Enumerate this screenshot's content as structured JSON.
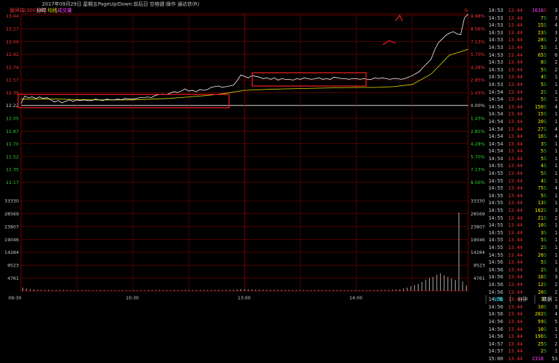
{
  "header": {
    "stock": "銀貝端(300322)",
    "date": "2017年09月29日 星期五",
    "hint": "PageUp/Down:前后日 空格键:操作 通达信(R)",
    "label_minute": "分时",
    "label_avg": "均线",
    "label_vol": "成交量",
    "right_flag": "①"
  },
  "colors": {
    "bg": "#000000",
    "grid": "#800000",
    "price": "#ffffff",
    "avg": "#e8e800",
    "up": "#ff3030",
    "down": "#30d030",
    "flat": "#d0d0d0",
    "volume": "#b0b0b0",
    "box": "#ff2020",
    "text": "#c8c8c8"
  },
  "price_axis": {
    "base": 12.22,
    "left_labels": [
      "13.44",
      "13.27",
      "13.09",
      "12.92",
      "12.74",
      "12.57",
      "12.39",
      "12.22",
      "12.05",
      "11.87",
      "11.70",
      "11.52",
      "11.35",
      "11.17"
    ],
    "right_labels": [
      "9.98%",
      "8.56%",
      "7.13%",
      "5.70%",
      "4.28%",
      "2.85%",
      "1.43%",
      "0.00%",
      "1.43%",
      "2.85%",
      "4.28%",
      "5.70%",
      "7.13%",
      "8.56%"
    ]
  },
  "volume_axis": {
    "labels": [
      "33330",
      "28569",
      "23807",
      "19046",
      "14284",
      "9523",
      "4761"
    ],
    "max": 33330
  },
  "time_axis": [
    "09:30",
    "10:30",
    "13:00",
    "14:00"
  ],
  "chart_data": {
    "type": "line",
    "x_range": [
      0,
      240
    ],
    "y_range": [
      10.998,
      13.442
    ],
    "series": [
      {
        "x": [
          0,
          2,
          4,
          6,
          8,
          10,
          12,
          14,
          16,
          18,
          20,
          22,
          24,
          26,
          28,
          30,
          32,
          34,
          36,
          38,
          40,
          42,
          44,
          46,
          48,
          50,
          52,
          54,
          56,
          58,
          60,
          62,
          64,
          66,
          68,
          70,
          72,
          74,
          76,
          78,
          80,
          82,
          84,
          86,
          88,
          90,
          92,
          94,
          96,
          98,
          100,
          102,
          104,
          106,
          108,
          110,
          112,
          114,
          116,
          118,
          120,
          122,
          124,
          126,
          128,
          130,
          132,
          134,
          136,
          138,
          140,
          142,
          144,
          146,
          148,
          150,
          152,
          154,
          156,
          158,
          160,
          162,
          164,
          166,
          168,
          170,
          172,
          174,
          176,
          178,
          180,
          182,
          184,
          186,
          188,
          190,
          192,
          194,
          196,
          198,
          200,
          202,
          204,
          206,
          208,
          210,
          212,
          214,
          216,
          218,
          220,
          222,
          224,
          226,
          228,
          230,
          232,
          234,
          236,
          238,
          240
        ],
        "values": [
          12.22,
          12.32,
          12.3,
          12.31,
          12.29,
          12.31,
          12.29,
          12.3,
          12.27,
          12.24,
          12.26,
          12.23,
          12.25,
          12.27,
          12.25,
          12.27,
          12.26,
          12.27,
          12.26,
          12.26,
          12.28,
          12.27,
          12.26,
          12.28,
          12.27,
          12.27,
          12.28,
          12.27,
          12.29,
          12.28,
          12.28,
          12.29,
          12.3,
          12.3,
          12.31,
          12.3,
          12.33,
          12.34,
          12.35,
          12.34,
          12.36,
          12.38,
          12.37,
          12.39,
          12.42,
          12.39,
          12.4,
          12.38,
          12.41,
          12.4,
          12.41,
          12.44,
          12.45,
          12.46,
          12.44,
          12.45,
          12.46,
          12.47,
          12.53,
          12.61,
          12.59,
          12.57,
          12.6,
          12.59,
          12.58,
          12.56,
          12.57,
          12.55,
          12.57,
          12.54,
          12.56,
          12.55,
          12.55,
          12.54,
          12.56,
          12.55,
          12.57,
          12.56,
          12.55,
          12.56,
          12.57,
          12.55,
          12.56,
          12.55,
          12.58,
          12.57,
          12.56,
          12.56,
          12.55,
          12.56,
          12.56,
          12.55,
          12.56,
          12.55,
          12.55,
          12.57,
          12.56,
          12.57,
          12.56,
          12.55,
          12.56,
          12.56,
          12.55,
          12.56,
          12.58,
          12.6,
          12.63,
          12.66,
          12.72,
          12.77,
          12.82,
          12.95,
          13.05,
          13.1,
          13.15,
          13.18,
          13.2,
          13.17,
          13.16,
          13.39,
          13.44
        ]
      },
      {
        "x": [
          0,
          20,
          40,
          60,
          80,
          100,
          110,
          120,
          140,
          160,
          180,
          190,
          200,
          210,
          220,
          230,
          240
        ],
        "values": [
          12.28,
          12.28,
          12.27,
          12.27,
          12.29,
          12.33,
          12.36,
          12.4,
          12.42,
          12.43,
          12.44,
          12.44,
          12.45,
          12.48,
          12.62,
          12.88,
          12.96
        ]
      }
    ],
    "volume": [
      1200,
      900,
      600,
      500,
      450,
      400,
      380,
      420,
      350,
      300,
      320,
      360,
      300,
      280,
      260,
      250,
      280,
      300,
      260,
      240,
      230,
      260,
      240,
      220,
      250,
      230,
      210,
      240,
      220,
      200,
      260,
      240,
      230,
      250,
      300,
      280,
      320,
      340,
      300,
      280,
      260,
      300,
      280,
      340,
      380,
      320,
      300,
      280,
      300,
      320,
      400,
      360,
      380,
      420,
      360,
      400,
      380,
      420,
      500,
      700,
      650,
      600,
      560,
      520,
      480,
      450,
      430,
      420,
      400,
      380,
      360,
      380,
      360,
      340,
      320,
      300,
      320,
      300,
      280,
      300,
      320,
      300,
      280,
      300,
      330,
      310,
      300,
      280,
      270,
      290,
      300,
      280,
      260,
      280,
      300,
      320,
      340,
      360,
      380,
      420,
      460,
      520,
      620,
      900,
      1200,
      1800,
      2200,
      2600,
      3400,
      4200,
      4800,
      5200,
      6000,
      6500,
      5800,
      5200,
      4600,
      4000,
      29000,
      3500,
      2000
    ]
  },
  "trades": [
    {
      "t": "14:53",
      "p": "13.44",
      "v": "1616",
      "d": "S",
      "n": "3",
      "dc": "#ff3030",
      "vc": "#ff40ff"
    },
    {
      "t": "14:53",
      "p": "13.44",
      "v": "7",
      "d": "S",
      "n": "3",
      "dc": "#30d030",
      "vc": "#e8e800"
    },
    {
      "t": "14:53",
      "p": "13.44",
      "v": "15",
      "d": "S",
      "n": "4",
      "dc": "#30d030",
      "vc": "#e8e800"
    },
    {
      "t": "14:53",
      "p": "13.44",
      "v": "23",
      "d": "S",
      "n": "3",
      "dc": "#30d030",
      "vc": "#e8e800"
    },
    {
      "t": "14:53",
      "p": "13.44",
      "v": "28",
      "d": "S",
      "n": "2",
      "dc": "#30d030",
      "vc": "#e8e800"
    },
    {
      "t": "14:53",
      "p": "13.44",
      "v": "5",
      "d": "S",
      "n": "1",
      "dc": "#30d030",
      "vc": "#e8e800"
    },
    {
      "t": "14:53",
      "p": "13.44",
      "v": "65",
      "d": "S",
      "n": "6",
      "dc": "#30d030",
      "vc": "#e8e800"
    },
    {
      "t": "14:53",
      "p": "13.44",
      "v": "8",
      "d": "S",
      "n": "2",
      "dc": "#30d030",
      "vc": "#e8e800"
    },
    {
      "t": "14:53",
      "p": "13.44",
      "v": "5",
      "d": "S",
      "n": "2",
      "dc": "#30d030",
      "vc": "#e8e800"
    },
    {
      "t": "14:53",
      "p": "13.44",
      "v": "4",
      "d": "S",
      "n": "1",
      "dc": "#30d030",
      "vc": "#e8e800"
    },
    {
      "t": "14:53",
      "p": "13.44",
      "v": "5",
      "d": "S",
      "n": "1",
      "dc": "#30d030",
      "vc": "#e8e800"
    },
    {
      "t": "14:54",
      "p": "13.44",
      "v": "2",
      "d": "S",
      "n": "1",
      "dc": "#30d030",
      "vc": "#e8e800"
    },
    {
      "t": "14:54",
      "p": "13.44",
      "v": "5",
      "d": "S",
      "n": "1",
      "dc": "#30d030",
      "vc": "#e8e800"
    },
    {
      "t": "14:54",
      "p": "13.44",
      "v": "150",
      "d": "S",
      "n": "4",
      "dc": "#30d030",
      "vc": "#e8e800"
    },
    {
      "t": "14:54",
      "p": "13.44",
      "v": "15",
      "d": "S",
      "n": "1",
      "dc": "#30d030",
      "vc": "#e8e800"
    },
    {
      "t": "14:54",
      "p": "13.44",
      "v": "20",
      "d": "S",
      "n": "1",
      "dc": "#30d030",
      "vc": "#e8e800"
    },
    {
      "t": "14:54",
      "p": "13.44",
      "v": "27",
      "d": "S",
      "n": "4",
      "dc": "#30d030",
      "vc": "#e8e800"
    },
    {
      "t": "14:54",
      "p": "13.44",
      "v": "16",
      "d": "S",
      "n": "4",
      "dc": "#30d030",
      "vc": "#e8e800"
    },
    {
      "t": "14:54",
      "p": "13.44",
      "v": "3",
      "d": "S",
      "n": "1",
      "dc": "#30d030",
      "vc": "#e8e800"
    },
    {
      "t": "14:54",
      "p": "13.44",
      "v": "5",
      "d": "S",
      "n": "1",
      "dc": "#30d030",
      "vc": "#e8e800"
    },
    {
      "t": "14:54",
      "p": "13.44",
      "v": "5",
      "d": "S",
      "n": "1",
      "dc": "#30d030",
      "vc": "#e8e800"
    },
    {
      "t": "14:55",
      "p": "13.44",
      "v": "4",
      "d": "S",
      "n": "1",
      "dc": "#30d030",
      "vc": "#e8e800"
    },
    {
      "t": "14:55",
      "p": "13.44",
      "v": "5",
      "d": "S",
      "n": "1",
      "dc": "#30d030",
      "vc": "#e8e800"
    },
    {
      "t": "14:55",
      "p": "13.44",
      "v": "4",
      "d": "S",
      "n": "1",
      "dc": "#30d030",
      "vc": "#e8e800"
    },
    {
      "t": "14:55",
      "p": "13.44",
      "v": "75",
      "d": "S",
      "n": "4",
      "dc": "#30d030",
      "vc": "#e8e800"
    },
    {
      "t": "14:55",
      "p": "13.44",
      "v": "5",
      "d": "S",
      "n": "1",
      "dc": "#30d030",
      "vc": "#e8e800"
    },
    {
      "t": "14:55",
      "p": "13.44",
      "v": "13",
      "d": "S",
      "n": "1",
      "dc": "#30d030",
      "vc": "#e8e800"
    },
    {
      "t": "14:55",
      "p": "13.44",
      "v": "102",
      "d": "S",
      "n": "3",
      "dc": "#30d030",
      "vc": "#e8e800"
    },
    {
      "t": "14:55",
      "p": "13.44",
      "v": "21",
      "d": "S",
      "n": "2",
      "dc": "#30d030",
      "vc": "#e8e800"
    },
    {
      "t": "14:55",
      "p": "13.44",
      "v": "10",
      "d": "S",
      "n": "1",
      "dc": "#30d030",
      "vc": "#e8e800"
    },
    {
      "t": "14:55",
      "p": "13.44",
      "v": "3",
      "d": "S",
      "n": "1",
      "dc": "#30d030",
      "vc": "#e8e800"
    },
    {
      "t": "14:55",
      "p": "13.44",
      "v": "5",
      "d": "S",
      "n": "1",
      "dc": "#30d030",
      "vc": "#e8e800"
    },
    {
      "t": "14:55",
      "p": "13.44",
      "v": "2",
      "d": "S",
      "n": "1",
      "dc": "#30d030",
      "vc": "#e8e800"
    },
    {
      "t": "14:55",
      "p": "13.44",
      "v": "20",
      "d": "S",
      "n": "1",
      "dc": "#30d030",
      "vc": "#e8e800"
    },
    {
      "t": "14:56",
      "p": "13.44",
      "v": "5",
      "d": "S",
      "n": "1",
      "dc": "#30d030",
      "vc": "#e8e800"
    },
    {
      "t": "14:56",
      "p": "13.44",
      "v": "2",
      "d": "S",
      "n": "1",
      "dc": "#30d030",
      "vc": "#e8e800"
    },
    {
      "t": "14:56",
      "p": "13.44",
      "v": "16",
      "d": "S",
      "n": "3",
      "dc": "#30d030",
      "vc": "#e8e800"
    },
    {
      "t": "14:56",
      "p": "13.44",
      "v": "12",
      "d": "S",
      "n": "2",
      "dc": "#30d030",
      "vc": "#e8e800"
    },
    {
      "t": "14:56",
      "p": "13.44",
      "v": "20",
      "d": "S",
      "n": "2",
      "dc": "#30d030",
      "vc": "#e8e800"
    },
    {
      "t": "14:56",
      "p": "13.44",
      "v": "3",
      "d": "S",
      "n": "1",
      "dc": "#30d030",
      "vc": "#e8e800"
    },
    {
      "t": "14:56",
      "p": "13.44",
      "v": "10",
      "d": "S",
      "n": "3",
      "dc": "#30d030",
      "vc": "#e8e800"
    },
    {
      "t": "14:56",
      "p": "13.44",
      "v": "202",
      "d": "S",
      "n": "4",
      "dc": "#30d030",
      "vc": "#e8e800"
    },
    {
      "t": "14:56",
      "p": "13.44",
      "v": "59",
      "d": "S",
      "n": "5",
      "dc": "#30d030",
      "vc": "#e8e800"
    },
    {
      "t": "14:56",
      "p": "13.44",
      "v": "10",
      "d": "S",
      "n": "1",
      "dc": "#30d030",
      "vc": "#e8e800"
    },
    {
      "t": "14:56",
      "p": "13.44",
      "v": "196",
      "d": "S",
      "n": "1",
      "dc": "#30d030",
      "vc": "#e8e800"
    },
    {
      "t": "14:57",
      "p": "13.44",
      "v": "25",
      "d": "S",
      "n": "2",
      "dc": "#30d030",
      "vc": "#e8e800"
    },
    {
      "t": "14:57",
      "p": "13.44",
      "v": "2",
      "d": "S",
      "n": "1",
      "dc": "#30d030",
      "vc": "#e8e800"
    },
    {
      "t": "15:00",
      "p": "13.44",
      "v": "2318",
      "d": "",
      "n": "53",
      "dc": "#30d030",
      "vc": "#ff40ff"
    }
  ],
  "tabs": [
    {
      "label": "分笔",
      "active": true
    },
    {
      "label": "分钟",
      "active": false
    },
    {
      "label": "数据",
      "active": false
    }
  ]
}
